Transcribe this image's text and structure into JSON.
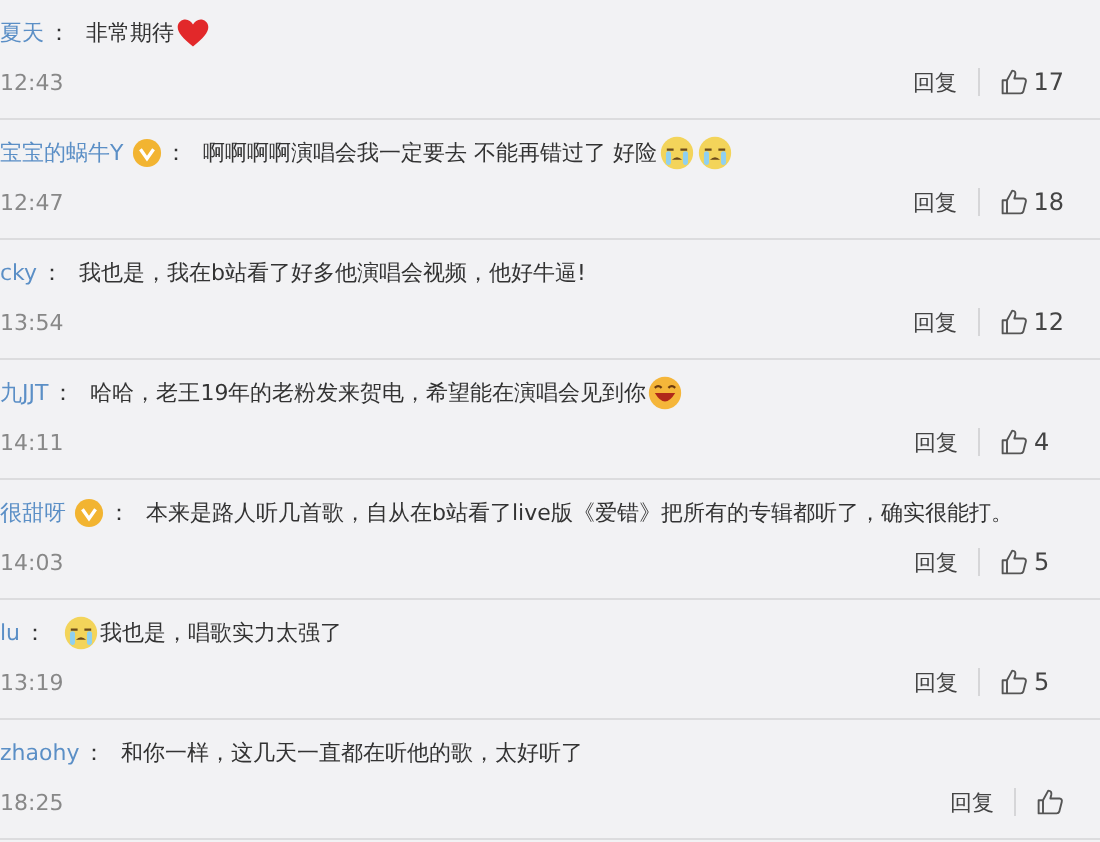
{
  "comments": [
    {
      "user": "夏天",
      "verified": false,
      "separator": "：",
      "text": "非常期待",
      "emoji_after": [
        {
          "kind": "heart"
        }
      ],
      "time": "12:43",
      "reply": "回复",
      "likes": "17"
    },
    {
      "user": "宝宝的蜗牛Y",
      "verified": true,
      "separator": "：",
      "text": "啊啊啊啊演唱会我一定要去 不能再错过了 好险",
      "emoji_after": [
        {
          "kind": "crying"
        },
        {
          "kind": "crying"
        }
      ],
      "time": "12:47",
      "reply": "回复",
      "likes": "18"
    },
    {
      "user": "cky",
      "verified": false,
      "separator": "：",
      "text": "我也是，我在b站看了好多他演唱会视频，他好牛逼!",
      "time": "13:54",
      "reply": "回复",
      "likes": "12"
    },
    {
      "user": "九JJT",
      "verified": false,
      "separator": "：",
      "text": "哈哈，老王19年的老粉发来贺电，希望能在演唱会见到你",
      "emoji_after": [
        {
          "kind": "laughing"
        }
      ],
      "time": "14:11",
      "reply": "回复",
      "likes": "4"
    },
    {
      "user": "很甜呀",
      "verified": true,
      "separator": "：",
      "text": "本来是路人听几首歌，自从在b站看了live版《爱错》把所有的专辑都听了，确实很能打。",
      "time": "14:03",
      "reply": "回复",
      "likes": "5"
    },
    {
      "user": "lu",
      "verified": false,
      "separator": "：",
      "emoji_before": [
        {
          "kind": "crying"
        }
      ],
      "text": "我也是，唱歌实力太强了",
      "time": "13:19",
      "reply": "回复",
      "likes": "5"
    },
    {
      "user": "zhaohy",
      "verified": false,
      "separator": "：",
      "text": "和你一样，这几天一直都在听他的歌，太好听了",
      "time": "18:25",
      "reply": "回复"
    }
  ]
}
